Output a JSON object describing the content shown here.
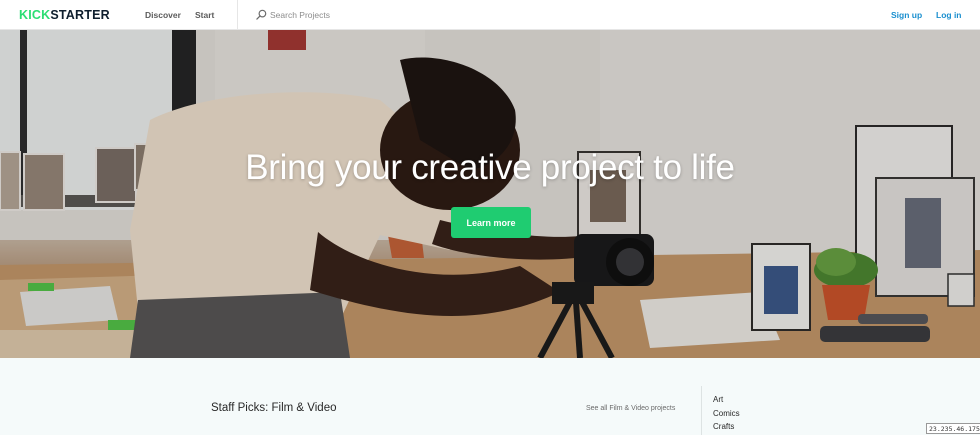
{
  "header": {
    "logo_kick": "KICK",
    "logo_starter": "STARTER",
    "nav": {
      "discover": "Discover",
      "start": "Start"
    },
    "search": {
      "placeholder": "Search Projects"
    },
    "auth": {
      "signup": "Sign up",
      "login": "Log in"
    }
  },
  "hero": {
    "headline": "Bring your creative project to life",
    "cta_label": "Learn more"
  },
  "staff_picks": {
    "title": "Staff Picks: Film & Video",
    "see_all": "See all Film & Video projects"
  },
  "categories": [
    "Art",
    "Comics",
    "Crafts"
  ],
  "ip_badge": "23.235.46.175",
  "colors": {
    "brand_green": "#2bde73",
    "cta_green": "#1fcc71",
    "link_blue": "#1a8fcf",
    "logo_dark": "#0f1f2e"
  },
  "icons": {
    "search": "search-icon"
  }
}
